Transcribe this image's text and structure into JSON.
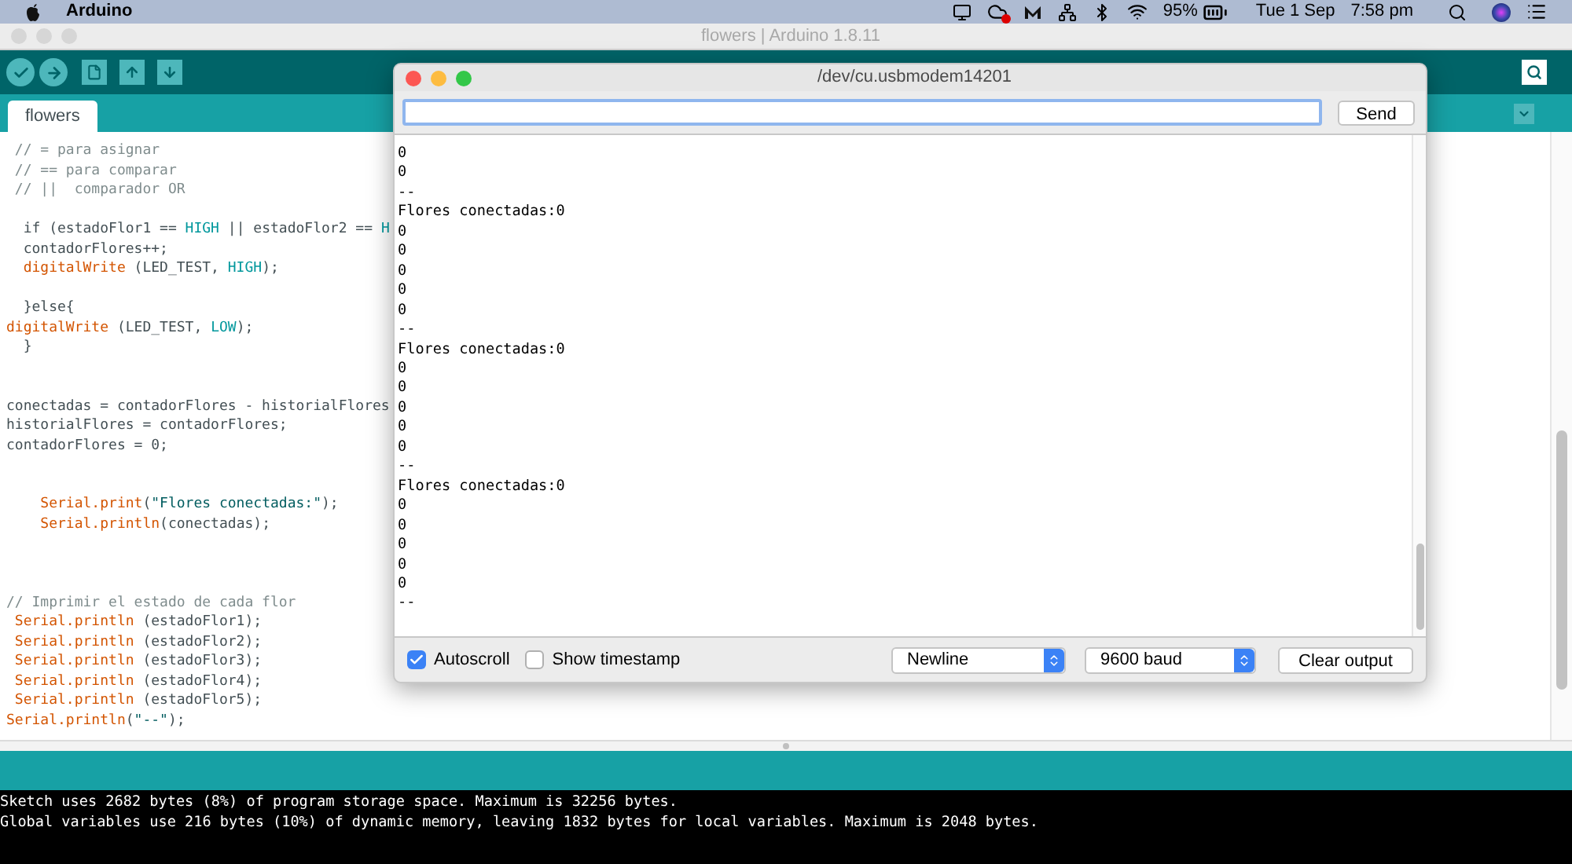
{
  "menubar": {
    "app": "Arduino",
    "battery": "95%",
    "date": "Tue 1 Sep",
    "time": "7:58 pm"
  },
  "window": {
    "title": "flowers | Arduino 1.8.11"
  },
  "tabs": [
    {
      "label": "flowers",
      "selected": true
    }
  ],
  "editor": {
    "lines": [
      {
        "kind": "code",
        "segments": [
          {
            "text": " // = para asignar",
            "kind": "comment"
          }
        ]
      },
      {
        "kind": "code",
        "segments": [
          {
            "text": " // == para comparar",
            "kind": "comment"
          }
        ]
      },
      {
        "kind": "code",
        "segments": [
          {
            "text": " // ||  comparador OR",
            "kind": "comment"
          }
        ]
      },
      {
        "kind": "blank"
      },
      {
        "kind": "code",
        "segments": [
          {
            "text": "  if (estadoFlor1 == ",
            "kind": "plain"
          },
          {
            "text": "HIGH",
            "kind": "constant"
          },
          {
            "text": " || estadoFlor2 == ",
            "kind": "plain"
          },
          {
            "text": "H",
            "kind": "constant"
          }
        ]
      },
      {
        "kind": "code",
        "segments": [
          {
            "text": "  contadorFlores++;",
            "kind": "plain"
          }
        ]
      },
      {
        "kind": "code",
        "segments": [
          {
            "text": "  digitalWrite",
            "kind": "function"
          },
          {
            "text": " (LED_TEST, ",
            "kind": "plain"
          },
          {
            "text": "HIGH",
            "kind": "constant"
          },
          {
            "text": ");",
            "kind": "plain"
          }
        ]
      },
      {
        "kind": "blank"
      },
      {
        "kind": "code",
        "segments": [
          {
            "text": "  }else{",
            "kind": "plain"
          }
        ]
      },
      {
        "kind": "code",
        "segments": [
          {
            "text": "digitalWrite",
            "kind": "function"
          },
          {
            "text": " (LED_TEST, ",
            "kind": "plain"
          },
          {
            "text": "LOW",
            "kind": "constant"
          },
          {
            "text": ");",
            "kind": "plain"
          }
        ]
      },
      {
        "kind": "code",
        "segments": [
          {
            "text": "  }",
            "kind": "plain"
          }
        ]
      },
      {
        "kind": "blank"
      },
      {
        "kind": "blank"
      },
      {
        "kind": "code",
        "segments": [
          {
            "text": "conectadas = contadorFlores - historialFlores",
            "kind": "plain"
          }
        ]
      },
      {
        "kind": "code",
        "segments": [
          {
            "text": "historialFlores = contadorFlores;",
            "kind": "plain"
          }
        ]
      },
      {
        "kind": "code",
        "segments": [
          {
            "text": "contadorFlores = 0;",
            "kind": "plain"
          }
        ]
      },
      {
        "kind": "blank"
      },
      {
        "kind": "blank"
      },
      {
        "kind": "code",
        "segments": [
          {
            "text": "    Serial.print",
            "kind": "function"
          },
          {
            "text": "(",
            "kind": "plain"
          },
          {
            "text": "\"Flores conectadas:\"",
            "kind": "string"
          },
          {
            "text": ");",
            "kind": "plain"
          }
        ]
      },
      {
        "kind": "code",
        "segments": [
          {
            "text": "    Serial.println",
            "kind": "function"
          },
          {
            "text": "(conectadas);",
            "kind": "plain"
          }
        ]
      },
      {
        "kind": "blank"
      },
      {
        "kind": "blank"
      },
      {
        "kind": "blank"
      },
      {
        "kind": "code",
        "segments": [
          {
            "text": "// Imprimir el estado de cada flor",
            "kind": "comment"
          }
        ]
      },
      {
        "kind": "code",
        "segments": [
          {
            "text": " Serial.println",
            "kind": "function"
          },
          {
            "text": " (estadoFlor1);",
            "kind": "plain"
          }
        ]
      },
      {
        "kind": "code",
        "segments": [
          {
            "text": " Serial.println",
            "kind": "function"
          },
          {
            "text": " (estadoFlor2);",
            "kind": "plain"
          }
        ]
      },
      {
        "kind": "code",
        "segments": [
          {
            "text": " Serial.println",
            "kind": "function"
          },
          {
            "text": " (estadoFlor3);",
            "kind": "plain"
          }
        ]
      },
      {
        "kind": "code",
        "segments": [
          {
            "text": " Serial.println",
            "kind": "function"
          },
          {
            "text": " (estadoFlor4);",
            "kind": "plain"
          }
        ]
      },
      {
        "kind": "code",
        "segments": [
          {
            "text": " Serial.println",
            "kind": "function"
          },
          {
            "text": " (estadoFlor5);",
            "kind": "plain"
          }
        ]
      },
      {
        "kind": "code",
        "segments": [
          {
            "text": "Serial.println",
            "kind": "function"
          },
          {
            "text": "(",
            "kind": "plain"
          },
          {
            "text": "\"--\"",
            "kind": "string"
          },
          {
            "text": ");",
            "kind": "plain"
          }
        ]
      }
    ]
  },
  "console": {
    "lines": [
      "Sketch uses 2682 bytes (8%) of program storage space. Maximum is 32256 bytes.",
      "Global variables use 216 bytes (10%) of dynamic memory, leaving 1832 bytes for local variables. Maximum is 2048 bytes."
    ]
  },
  "serial_monitor": {
    "title": "/dev/cu.usbmodem14201",
    "send": "Send",
    "output": [
      "0",
      "0",
      "--",
      "Flores conectadas:0",
      "0",
      "0",
      "0",
      "0",
      "0",
      "--",
      "Flores conectadas:0",
      "0",
      "0",
      "0",
      "0",
      "0",
      "--",
      "Flores conectadas:0",
      "0",
      "0",
      "0",
      "0",
      "0",
      "--"
    ],
    "autoscroll": {
      "label": "Autoscroll",
      "checked": true
    },
    "timestamp": {
      "label": "Show timestamp",
      "checked": false
    },
    "line_ending": "Newline",
    "baud": "9600 baud",
    "clear": "Clear output"
  }
}
